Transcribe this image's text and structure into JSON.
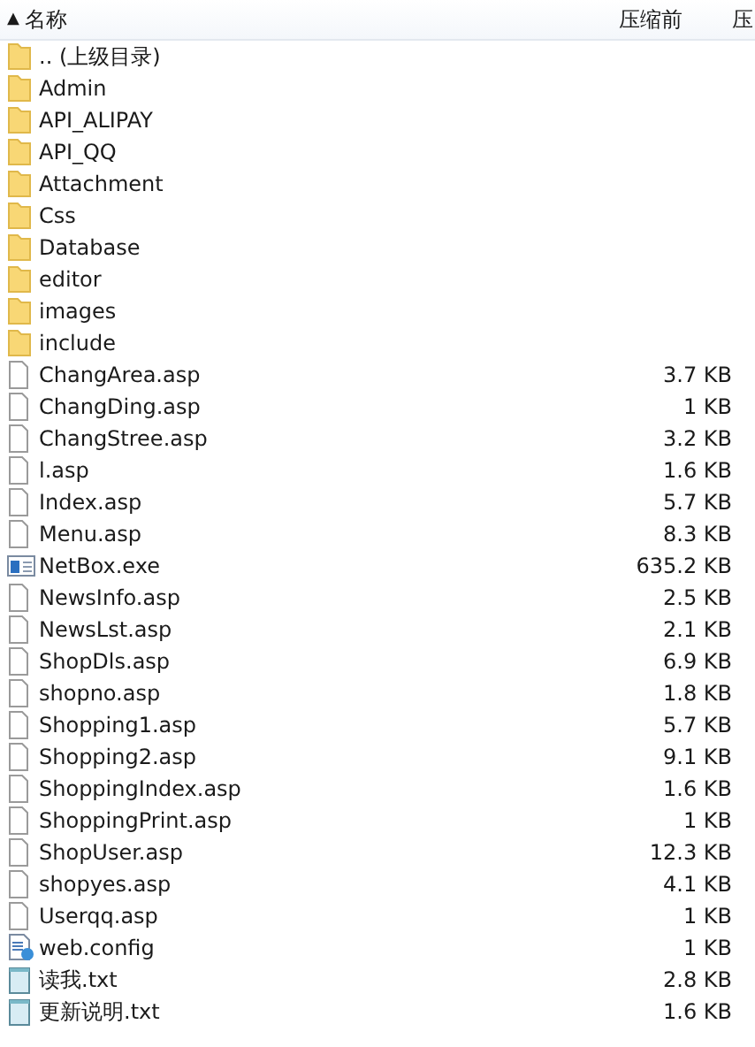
{
  "header": {
    "sort_arrow": "▲",
    "name": "名称",
    "size": "压缩前",
    "column_3": "压"
  },
  "rows": [
    {
      "kind": "folder",
      "name": ".. (上级目录)"
    },
    {
      "kind": "folder",
      "name": "Admin"
    },
    {
      "kind": "folder",
      "name": "API_ALIPAY"
    },
    {
      "kind": "folder",
      "name": "API_QQ"
    },
    {
      "kind": "folder",
      "name": "Attachment"
    },
    {
      "kind": "folder",
      "name": "Css"
    },
    {
      "kind": "folder",
      "name": "Database"
    },
    {
      "kind": "folder",
      "name": "editor"
    },
    {
      "kind": "folder",
      "name": "images"
    },
    {
      "kind": "folder",
      "name": "include"
    },
    {
      "kind": "file",
      "name": "ChangArea.asp",
      "size": "3.7 KB"
    },
    {
      "kind": "file",
      "name": "ChangDing.asp",
      "size": "1 KB"
    },
    {
      "kind": "file",
      "name": "ChangStree.asp",
      "size": "3.2 KB"
    },
    {
      "kind": "file",
      "name": "l.asp",
      "size": "1.6 KB"
    },
    {
      "kind": "file",
      "name": "Index.asp",
      "size": "5.7 KB"
    },
    {
      "kind": "file",
      "name": "Menu.asp",
      "size": "8.3 KB"
    },
    {
      "kind": "exe",
      "name": "NetBox.exe",
      "size": "635.2 KB"
    },
    {
      "kind": "file",
      "name": "NewsInfo.asp",
      "size": "2.5 KB"
    },
    {
      "kind": "file",
      "name": "NewsLst.asp",
      "size": "2.1 KB"
    },
    {
      "kind": "file",
      "name": "ShopDls.asp",
      "size": "6.9 KB"
    },
    {
      "kind": "file",
      "name": "shopno.asp",
      "size": "1.8 KB"
    },
    {
      "kind": "file",
      "name": "Shopping1.asp",
      "size": "5.7 KB"
    },
    {
      "kind": "file",
      "name": "Shopping2.asp",
      "size": "9.1 KB"
    },
    {
      "kind": "file",
      "name": "ShoppingIndex.asp",
      "size": "1.6 KB"
    },
    {
      "kind": "file",
      "name": "ShoppingPrint.asp",
      "size": "1 KB"
    },
    {
      "kind": "file",
      "name": "ShopUser.asp",
      "size": "12.3 KB"
    },
    {
      "kind": "file",
      "name": "shopyes.asp",
      "size": "4.1 KB"
    },
    {
      "kind": "file",
      "name": "Userqq.asp",
      "size": "1 KB"
    },
    {
      "kind": "config",
      "name": "web.config",
      "size": "1 KB"
    },
    {
      "kind": "text",
      "name": "读我.txt",
      "size": "2.8 KB"
    },
    {
      "kind": "text",
      "name": "更新说明.txt",
      "size": "1.6 KB"
    }
  ]
}
